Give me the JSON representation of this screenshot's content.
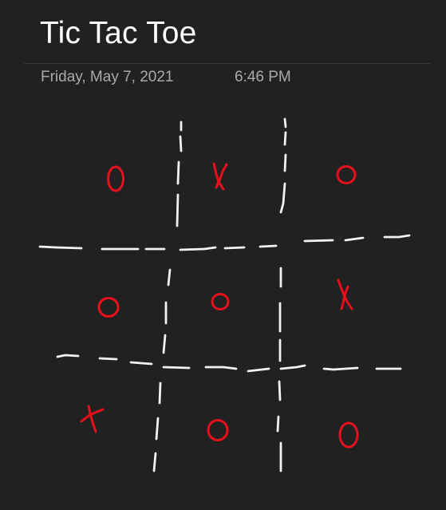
{
  "page": {
    "title": "Tic Tac Toe",
    "date": "Friday, May 7, 2021",
    "time": "6:46 PM"
  },
  "board": {
    "ink_colors": {
      "grid": "#f2f2f2",
      "marks": "#e8101c"
    },
    "cells": [
      [
        "O",
        "X",
        "O"
      ],
      [
        "O",
        "O",
        "X"
      ],
      [
        "X",
        "O",
        "O"
      ]
    ]
  }
}
